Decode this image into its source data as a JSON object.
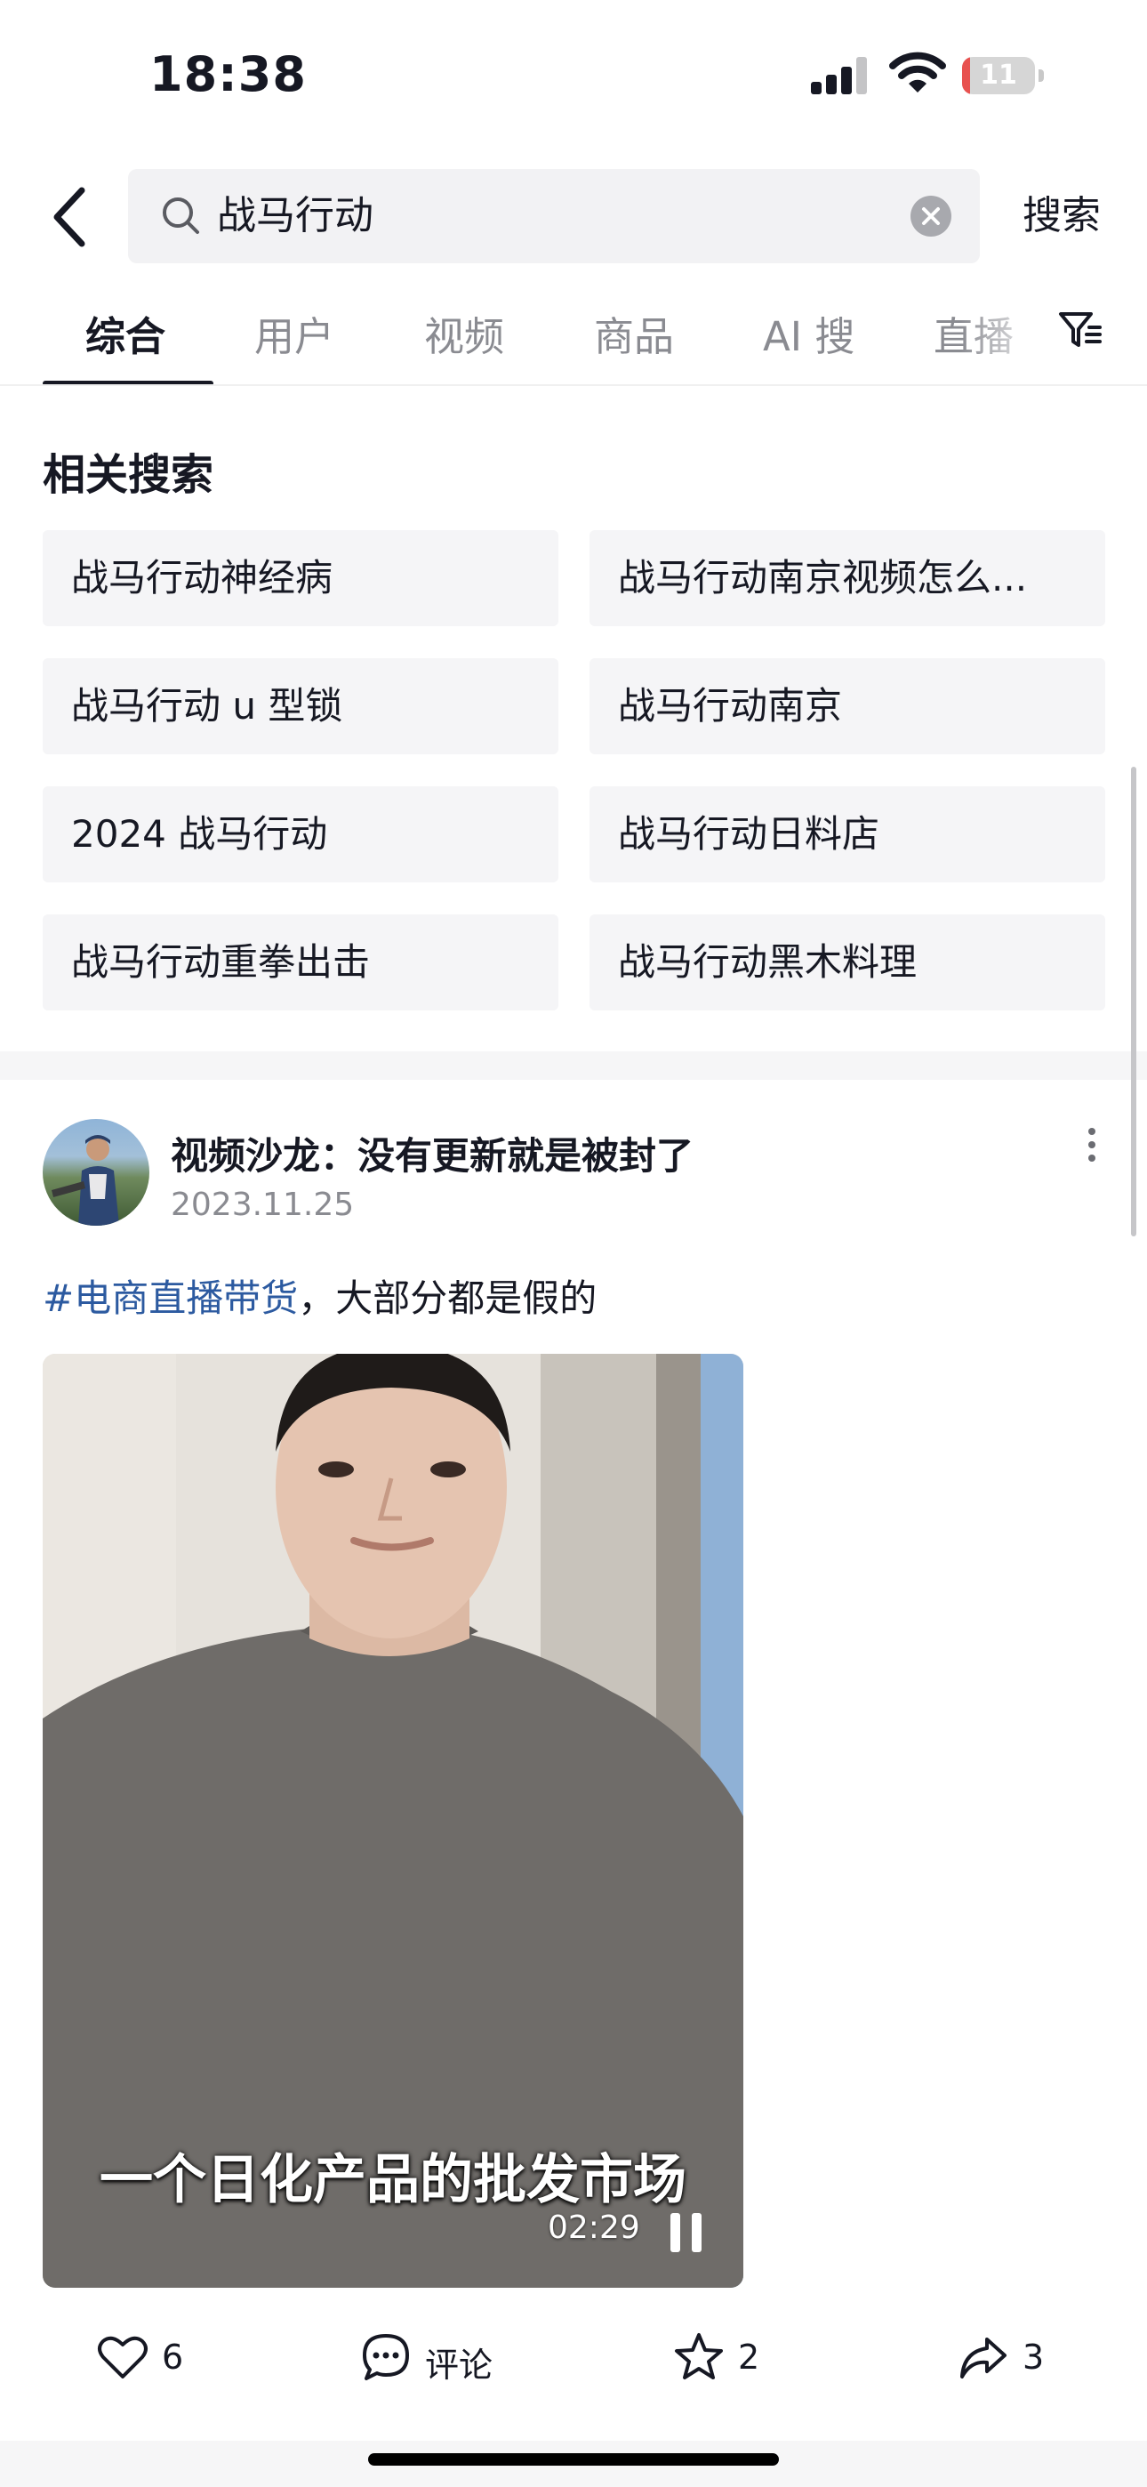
{
  "status_bar": {
    "time": "18:38",
    "battery_level": "11",
    "battery_color": "#e8514f",
    "icons": [
      "signal-icon",
      "wifi-icon",
      "battery-icon"
    ]
  },
  "search": {
    "query": "战马行动",
    "submit_label": "搜索",
    "icons": [
      "back-icon",
      "search-icon",
      "clear-icon"
    ]
  },
  "tabs": [
    {
      "label": "综合",
      "active": true
    },
    {
      "label": "用户"
    },
    {
      "label": "视频"
    },
    {
      "label": "商品"
    },
    {
      "label": "AI 搜"
    },
    {
      "label": "直播"
    }
  ],
  "filter_icon": "filter-icon",
  "related": {
    "title": "相关搜索",
    "items": [
      "战马行动神经病",
      "战马行动南京视频怎么...",
      "战马行动 u 型锁",
      "战马行动南京",
      "2024 战马行动",
      "战马行动日料店",
      "战马行动重拳出击",
      "战马行动黑木料理"
    ]
  },
  "post": {
    "author": "视频沙龙：没有更新就是被封了",
    "date": "2023.11.25",
    "hashtag": "#电商直播带货",
    "caption_rest": "，大部分都是假的",
    "video": {
      "subtitle": "一个日化产品的批发市场",
      "duration": "02:29",
      "state": "playing"
    },
    "actions": {
      "like_count": "6",
      "comment_label": "评论",
      "favorite_count": "2",
      "share_count": "3"
    }
  },
  "colors": {
    "text_primary": "#161823",
    "text_secondary": "#8a8b91",
    "hashtag": "#2c5aa0",
    "chip_bg": "#f5f5f7"
  }
}
